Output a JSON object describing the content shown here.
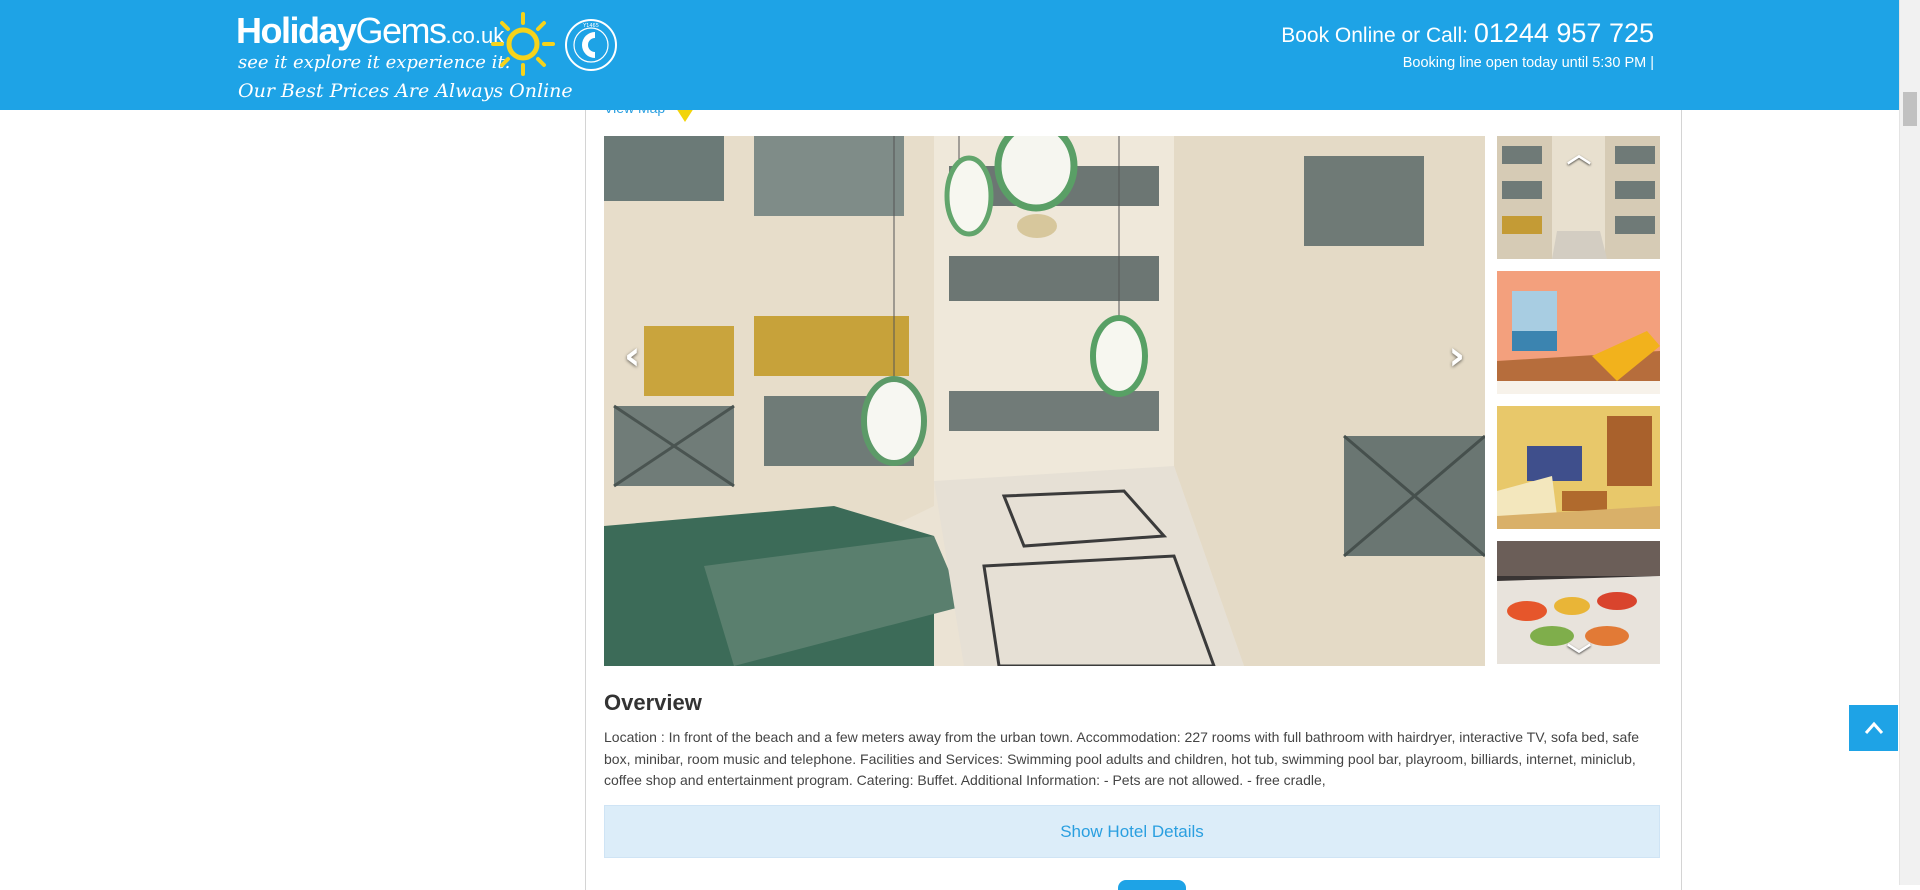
{
  "header": {
    "brand_bold": "Holiday",
    "brand_light": "Gems",
    "brand_domain": ".co.uk",
    "tagline": "see it  explore it  experience it.",
    "slogan": "Our Best Prices Are Always Online",
    "abta_code": "Y1465",
    "abta_label": "ABTA PROTECTED",
    "contact_prefix": "Book Online or Call: ",
    "phone": "01244 957 725",
    "hours": "Booking line open today until 5:30 PM |",
    "brand_color": "#1ea3e6"
  },
  "map": {
    "link_label": "View Map",
    "pin_icon": "map-pin-icon"
  },
  "gallery": {
    "prev_icon": "chevron-left-icon",
    "next_icon": "chevron-right-icon",
    "thumb_up_icon": "chevron-up-icon",
    "thumb_down_icon": "chevron-down-icon",
    "thumbnails": [
      "atrium-thumbnail",
      "balcony-thumbnail",
      "bedroom-thumbnail",
      "buffet-thumbnail"
    ]
  },
  "overview": {
    "title": "Overview",
    "text": "Location : In front of the beach and a few meters away from the urban town. Accommodation: 227 rooms with full bathroom with hairdryer, interactive TV, sofa bed, safe box, minibar, room music and telephone. Facilities and Services: Swimming pool adults and children, hot tub, swimming pool bar, playroom, billiards, internet, miniclub, coffee shop and entertainment program. Catering: Buffet. Additional Information: - Pets are not allowed. - free cradle,",
    "details_button": "Show Hotel Details"
  },
  "back_to_top_icon": "chevron-up-icon"
}
